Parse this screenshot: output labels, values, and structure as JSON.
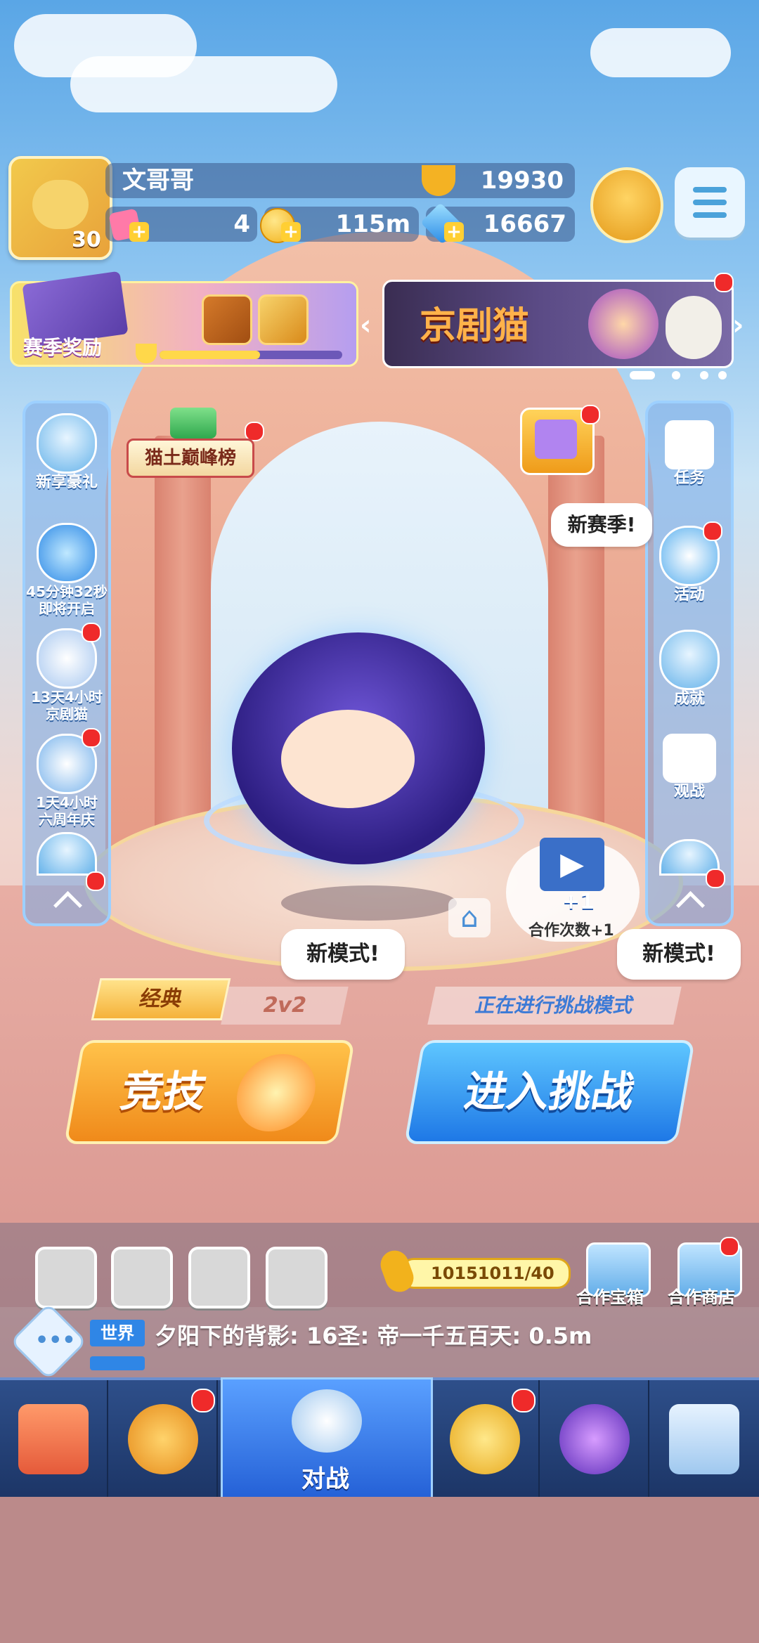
{
  "player": {
    "name": "文哥哥",
    "avatar_level": "30",
    "trophies": "19930",
    "stars": "4",
    "coins": "115m",
    "gems": "16667"
  },
  "season_reward": {
    "label": "赛季奖励",
    "progress": 0.55
  },
  "banner": {
    "title": "京剧猫",
    "page_count": 4,
    "active_page": 0
  },
  "left_sidebar": [
    {
      "label": "新享豪礼",
      "icon": "gift-icon"
    },
    {
      "label": "45分钟32秒\n即将开启",
      "icon": "demon-mask-icon"
    },
    {
      "label": "13天4小时\n京剧猫",
      "icon": "opera-cat-icon"
    },
    {
      "label": "1天4小时\n六周年庆",
      "icon": "cake-icon"
    },
    {
      "label": "",
      "icon": "star-wings-icon"
    }
  ],
  "right_sidebar": [
    {
      "label": "任务",
      "icon": "checklist-icon"
    },
    {
      "label": "活动",
      "icon": "party-popper-icon"
    },
    {
      "label": "成就",
      "icon": "crown-star-icon"
    },
    {
      "label": "观战",
      "icon": "tv-play-icon"
    },
    {
      "label": "",
      "icon": "ghost-icon"
    }
  ],
  "ranking_badge": "猫土巅峰榜",
  "bubbles": {
    "new_season": "新赛季!",
    "new_mode_left": "新模式!",
    "new_mode_right": "新模式!",
    "coop_count": "合作次数+1"
  },
  "video_reward": "+1",
  "modes": {
    "classic": "经典",
    "two_v_two": "2v2",
    "challenge_status": "正在进行挑战模式"
  },
  "buttons": {
    "compete": "竞技",
    "enter_challenge": "进入挑战"
  },
  "utility_buttons": [
    "lightning-box-icon",
    "triangle-rune-icon",
    "trophy-cup-icon",
    "film-icon"
  ],
  "key_progress": "10151011/40",
  "shops": {
    "coop_chest": "合作宝箱",
    "coop_shop": "合作商店"
  },
  "chat": {
    "channel": "世界",
    "message": "夕阳下的背影: 16圣: 帝一千五百天: 0.5m"
  },
  "nav": {
    "items": [
      "shop-icon",
      "gacha-orb-icon",
      "battle",
      "whistle-icon",
      "planet-icon",
      "message-heart-icon"
    ],
    "active_label": "对战"
  },
  "colors": {
    "primary_orange": "#f08a1a",
    "primary_blue": "#1e78e6",
    "notification": "#ef2a2a",
    "nav": "#1c3566"
  }
}
